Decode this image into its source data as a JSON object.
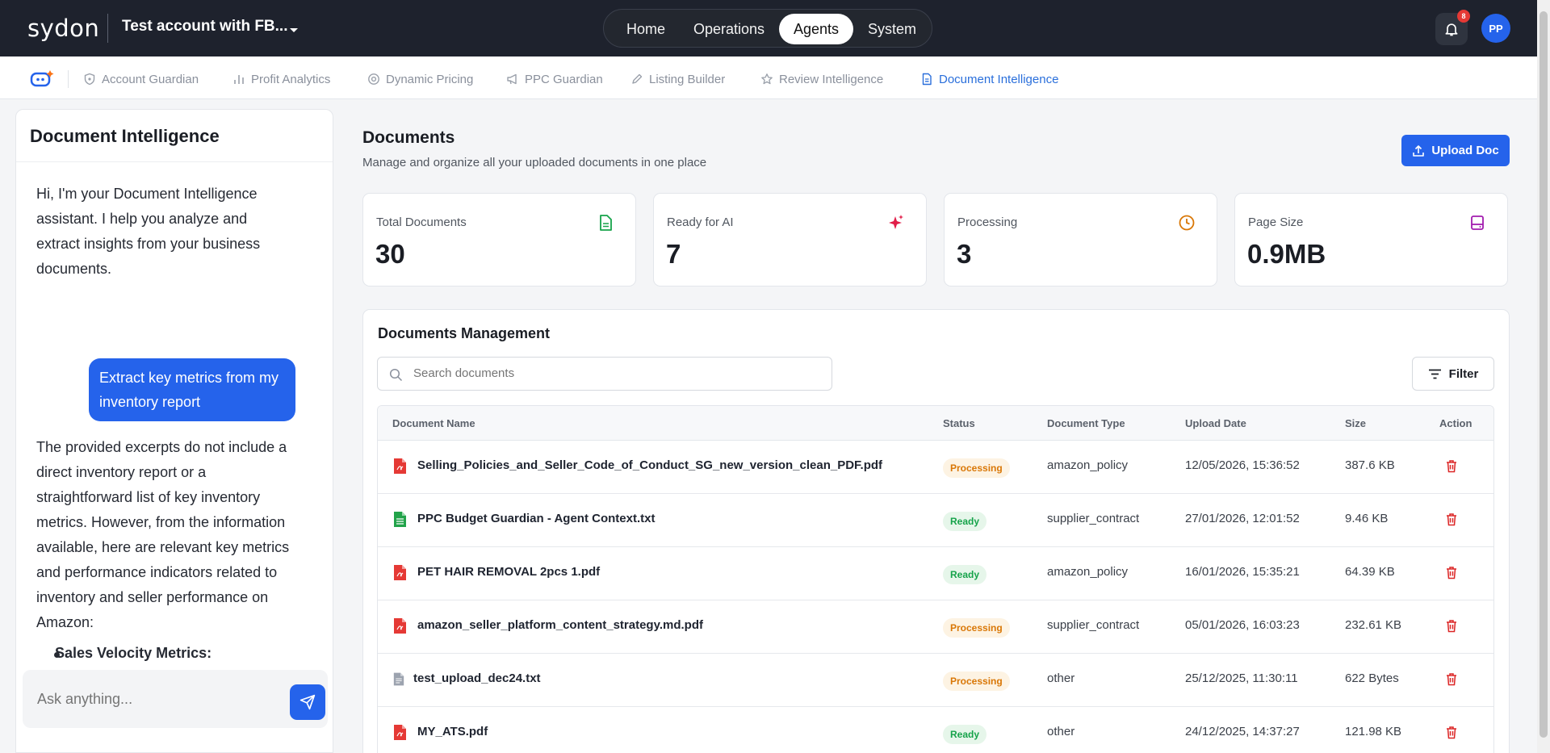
{
  "brand": {
    "logo_text": "sydon"
  },
  "account": {
    "name": "Test account with FB..."
  },
  "topnav": {
    "items": [
      {
        "label": "Home"
      },
      {
        "label": "Operations"
      },
      {
        "label": "Agents"
      },
      {
        "label": "System"
      }
    ],
    "active": "Agents"
  },
  "notifications": {
    "count": "8"
  },
  "user": {
    "initials": "PP"
  },
  "subnav": {
    "tabs": [
      {
        "label": "Account Guardian",
        "icon": "shield-icon"
      },
      {
        "label": "Profit Analytics",
        "icon": "bar-chart-icon"
      },
      {
        "label": "Dynamic Pricing",
        "icon": "dollar-circle-icon"
      },
      {
        "label": "PPC Guardian",
        "icon": "megaphone-icon"
      },
      {
        "label": "Listing Builder",
        "icon": "pen-icon"
      },
      {
        "label": "Review Intelligence",
        "icon": "star-icon"
      },
      {
        "label": "Document Intelligence",
        "icon": "document-icon"
      }
    ],
    "active": "Document Intelligence"
  },
  "chat": {
    "title": "Document Intelligence",
    "assistant_intro": "Hi, I'm your Document Intelligence assistant. I help you analyze and extract insights from your business documents.",
    "user_message": "Extract key metrics from my inventory report",
    "assistant_reply": "The provided excerpts do not include a direct inventory report or a straightforward list of key inventory metrics. However, from the information available, here are relevant key metrics and performance indicators related to inventory and seller performance on Amazon:",
    "bullet_heading": "Sales Velocity Metrics:",
    "input_placeholder": "Ask anything..."
  },
  "main": {
    "title": "Documents",
    "subtitle": "Manage and organize all your uploaded documents in one place",
    "upload_label": "Upload Doc"
  },
  "stats": [
    {
      "label": "Total Documents",
      "value": "30",
      "icon": "file-icon",
      "color": "#16a34a"
    },
    {
      "label": "Ready for AI",
      "value": "7",
      "icon": "sparkle-icon",
      "color": "#e11d48"
    },
    {
      "label": "Processing",
      "value": "3",
      "icon": "clock-icon",
      "color": "#d97706"
    },
    {
      "label": "Page Size",
      "value": "0.9MB",
      "icon": "drive-icon",
      "color": "#a21caf"
    }
  ],
  "documents": {
    "title": "Documents Management",
    "search_placeholder": "Search documents",
    "filter_label": "Filter",
    "columns": [
      "Document Name",
      "Status",
      "Document Type",
      "Upload Date",
      "Size",
      "Action"
    ],
    "rows": [
      {
        "name": "Selling_Policies_and_Seller_Code_of_Conduct_SG_new_version_clean_PDF.pdf",
        "file_type": "pdf",
        "status": "Processing",
        "type": "amazon_policy",
        "date": "12/05/2026, 15:36:52",
        "size": "387.6 KB"
      },
      {
        "name": "PPC Budget Guardian - Agent Context.txt",
        "file_type": "sheet",
        "status": "Ready",
        "type": "supplier_contract",
        "date": "27/01/2026, 12:01:52",
        "size": "9.46 KB"
      },
      {
        "name": "PET HAIR REMOVAL 2pcs 1.pdf",
        "file_type": "pdf",
        "status": "Ready",
        "type": "amazon_policy",
        "date": "16/01/2026, 15:35:21",
        "size": "64.39 KB"
      },
      {
        "name": "amazon_seller_platform_content_strategy.md.pdf",
        "file_type": "pdf",
        "status": "Processing",
        "type": "supplier_contract",
        "date": "05/01/2026, 16:03:23",
        "size": "232.61 KB"
      },
      {
        "name": "test_upload_dec24.txt",
        "file_type": "txt",
        "status": "Processing",
        "type": "other",
        "date": "25/12/2025, 11:30:11",
        "size": "622 Bytes"
      },
      {
        "name": "MY_ATS.pdf",
        "file_type": "pdf",
        "status": "Ready",
        "type": "other",
        "date": "24/12/2025, 14:37:27",
        "size": "121.98 KB"
      }
    ]
  },
  "colors": {
    "primary": "#2563eb",
    "topbar": "#1e222d",
    "processing": "#d97706",
    "ready": "#16a34a",
    "danger": "#dc2626"
  }
}
